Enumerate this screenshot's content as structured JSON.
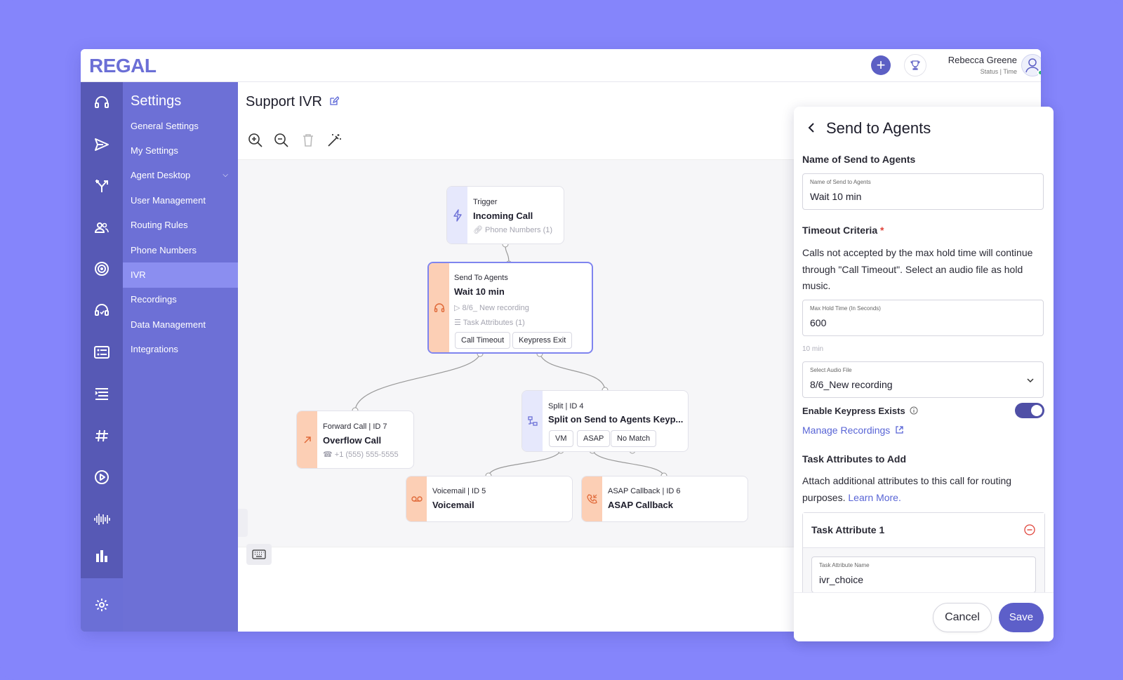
{
  "app": {
    "logo": "REGAL"
  },
  "header": {
    "user_name": "Rebecca Greene",
    "user_status": "Status | Time"
  },
  "rail": {
    "icons": [
      "headset-icon",
      "send-icon",
      "routing-icon",
      "users-icon",
      "at-sign-icon",
      "support-headset-icon",
      "card-list-icon",
      "list-icon",
      "hashtag-icon",
      "play-icon",
      "waveform-icon",
      "bar-chart-icon",
      "gear-icon"
    ]
  },
  "sidebar": {
    "title": "Settings",
    "items": [
      {
        "label": "General Settings"
      },
      {
        "label": "My Settings"
      },
      {
        "label": "Agent Desktop"
      },
      {
        "label": "User Management"
      },
      {
        "label": "Routing Rules"
      },
      {
        "label": "Phone Numbers"
      },
      {
        "label": "IVR"
      },
      {
        "label": "Recordings"
      },
      {
        "label": "Data Management"
      },
      {
        "label": "Integrations"
      }
    ],
    "active": "IVR"
  },
  "main": {
    "title": "Support IVR"
  },
  "flow": {
    "trigger": {
      "sub": "Trigger",
      "title": "Incoming Call",
      "meta": "Phone Numbers (1)"
    },
    "send_to_agents": {
      "sub": "Send To Agents",
      "title": "Wait 10 min",
      "meta1": "8/6_ New recording",
      "meta2": "Task Attributes (1)",
      "chips": [
        "Call Timeout",
        "Keypress Exit"
      ]
    },
    "forward": {
      "sub": "Forward Call | ID 7",
      "title": "Overflow Call",
      "meta": "+1 (555) 555-5555"
    },
    "split": {
      "sub": "Split | ID 4",
      "title": "Split on Send to Agents Keyp...",
      "chips": [
        "VM",
        "ASAP",
        "No Match"
      ]
    },
    "voicemail": {
      "sub": "Voicemail | ID 5",
      "title": "Voicemail"
    },
    "callback": {
      "sub": "ASAP Callback | ID 6",
      "title": "ASAP Callback"
    }
  },
  "panel": {
    "title": "Send to Agents",
    "name_heading": "Name of Send to Agents",
    "name_field": {
      "label": "Name of Send to Agents",
      "value": "Wait 10 min"
    },
    "timeout_heading": "Timeout Criteria",
    "required_mark": "*",
    "timeout_desc": "Calls not accepted by the max hold time will continue through \"Call Timeout\". Select an audio file as hold music.",
    "hold_field": {
      "label": "Max Hold Time (In Seconds)",
      "value": "600"
    },
    "hold_hint": "10 min",
    "audio_field": {
      "label": "Select Audio File",
      "value": "8/6_New recording"
    },
    "keypress_label": "Enable Keypress Exists",
    "keypress_enabled": true,
    "manage_link": "Manage Recordings",
    "attrs_heading": "Task Attributes to Add",
    "attrs_desc": "Attach additional attributes to this call for routing purposes.",
    "learn_more": "Learn More.",
    "attr1": {
      "title": "Task Attribute 1",
      "name_label": "Task Attribute Name",
      "name_value": "ivr_choice"
    },
    "cancel": "Cancel",
    "save": "Save"
  },
  "colors": {
    "accent": "#5d5fc9",
    "rail": "#5759b5",
    "sidebar": "#6d70d6",
    "background": "#8585fb",
    "orange_strip": "#fccfb5",
    "blue_strip": "#e6e8fc"
  }
}
